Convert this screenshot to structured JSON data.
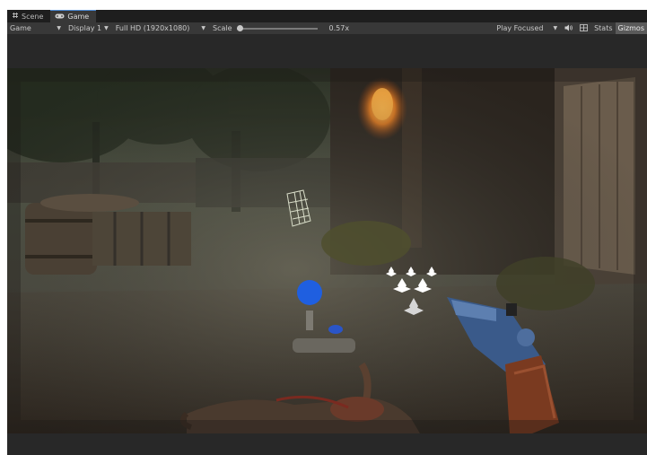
{
  "tabs": [
    {
      "label": "Scene",
      "icon": "scene-grid-icon"
    },
    {
      "label": "Game",
      "icon": "gamepad-icon"
    }
  ],
  "toolbar": {
    "view_dropdown": "Game",
    "display_dropdown": "Display 1",
    "resolution_dropdown": "Full HD (1920x1080)",
    "scale_label": "Scale",
    "scale_value": "0.57x",
    "scale_fraction": 0.0,
    "play_mode_dropdown": "Play Focused",
    "mute_icon": "speaker-icon",
    "stats_icon": "stats-grid-icon",
    "stats_label": "Stats",
    "gizmos_label": "Gizmos"
  },
  "colors": {
    "editor_bg": "#282828",
    "toolbar_bg": "#383838",
    "tab_accent": "#4d8cd6",
    "blue_marker": "#1f5fe0"
  }
}
